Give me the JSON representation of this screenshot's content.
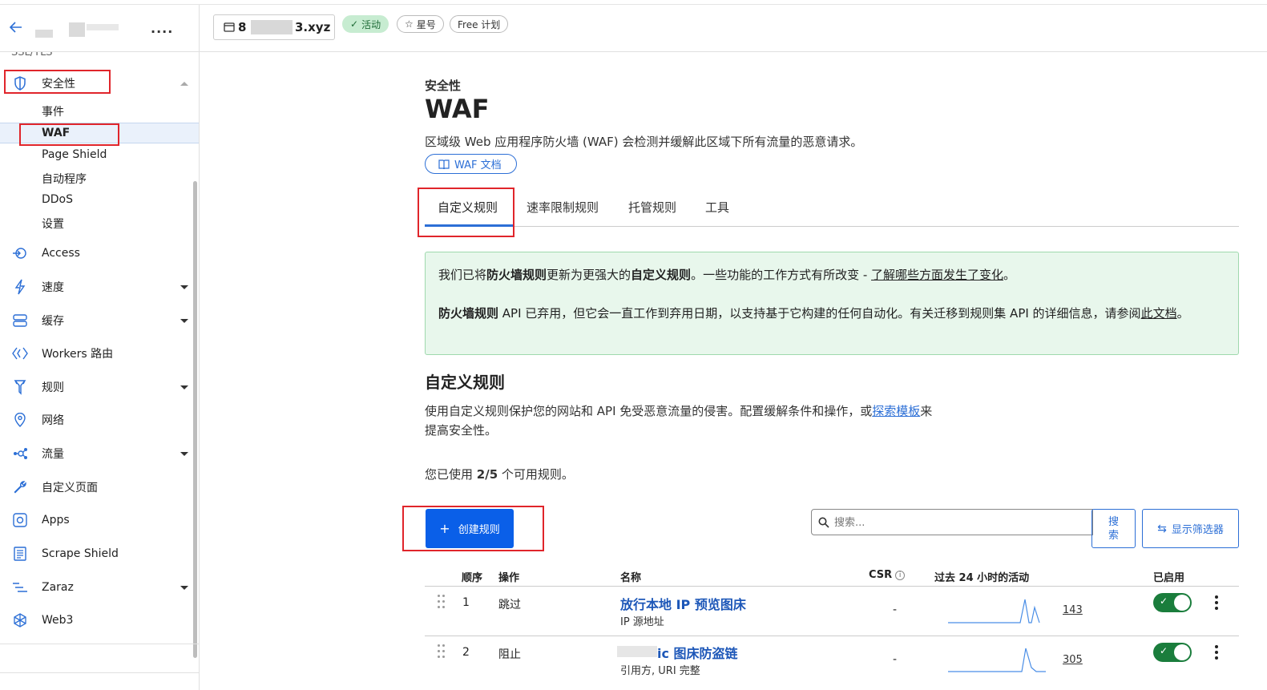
{
  "header": {
    "domain_prefix": "8",
    "domain_suffix": "3.xyz",
    "status_badge": "活动",
    "star_label": "星号",
    "plan_label": "Free 计划",
    "more": "...."
  },
  "sidebar": {
    "cut_label": "SSL/TLS",
    "security": {
      "label": "安全性"
    },
    "security_children": [
      {
        "label": "事件"
      },
      {
        "label": "WAF"
      },
      {
        "label": "Page Shield"
      },
      {
        "label": "自动程序"
      },
      {
        "label": "DDoS"
      },
      {
        "label": "设置"
      }
    ],
    "items": [
      {
        "label": "Access",
        "icon": "access-icon"
      },
      {
        "label": "速度",
        "icon": "lightning-icon"
      },
      {
        "label": "缓存",
        "icon": "cache-icon"
      },
      {
        "label": "Workers 路由",
        "icon": "workers-icon"
      },
      {
        "label": "规则",
        "icon": "rules-icon"
      },
      {
        "label": "网络",
        "icon": "location-pin-icon"
      },
      {
        "label": "流量",
        "icon": "traffic-icon"
      },
      {
        "label": "自定义页面",
        "icon": "wrench-icon"
      },
      {
        "label": "Apps",
        "icon": "apps-icon"
      },
      {
        "label": "Scrape Shield",
        "icon": "document-icon"
      },
      {
        "label": "Zaraz",
        "icon": "zaraz-icon"
      },
      {
        "label": "Web3",
        "icon": "web3-icon"
      }
    ]
  },
  "page": {
    "breadcrumb": "安全性",
    "title": "WAF",
    "description": "区域级 Web 应用程序防火墙 (WAF) 会检测并缓解此区域下所有流量的恶意请求。",
    "doc_button": "WAF 文档"
  },
  "tabs": [
    {
      "label": "自定义规则"
    },
    {
      "label": "速率限制规则"
    },
    {
      "label": "托管规则"
    },
    {
      "label": "工具"
    }
  ],
  "notice": {
    "p1_a": "我们已将",
    "p1_b": "防火墙规则",
    "p1_c": "更新为更强大的",
    "p1_d": "自定义规则",
    "p1_e": "。一些功能的工作方式有所改变 - ",
    "p1_link": "了解哪些方面发生了变化",
    "p1_f": "。",
    "p2_b": "防火墙规则",
    "p2_a": " API 已弃用，但它会一直工作到弃用日期，以支持基于它构建的任何自动化。有关迁移到规则集 API 的详细信息，请参阅",
    "p2_link": "此文档",
    "p2_c": "。"
  },
  "custom_rules": {
    "title": "自定义规则",
    "desc_a": "使用自定义规则保护您的网站和 API 免受恶意流量的侵害。配置缓解条件和操作，或",
    "desc_link": "探索模板",
    "desc_b": "来提高安全性。",
    "usage_a": "您已使用 ",
    "usage_b": "2/5",
    "usage_c": " 个可用规则。",
    "create_button": "创建规则",
    "search_placeholder": "搜索...",
    "search_button": "搜索",
    "filter_button": "显示筛选器"
  },
  "table": {
    "headers": {
      "order": "顺序",
      "action": "操作",
      "name": "名称",
      "csr": "CSR",
      "activity": "过去 24 小时的活动",
      "enabled": "已启用"
    },
    "rows": [
      {
        "order": "1",
        "action": "跳过",
        "name": "放行本地 IP 预览图床",
        "subtitle": "IP 源地址",
        "csr": "-",
        "count": "143",
        "enabled": true
      },
      {
        "order": "2",
        "action": "阻止",
        "name": "ic 图床防盗链",
        "subtitle": "引用方, URI 完整",
        "csr": "-",
        "count": "305",
        "enabled": true
      }
    ]
  }
}
